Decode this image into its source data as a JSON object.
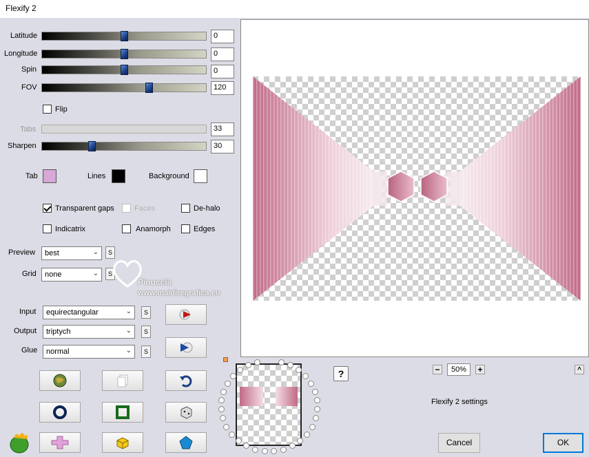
{
  "window": {
    "title": "Flexify 2"
  },
  "sliders": [
    {
      "id": "latitude",
      "label": "Latitude",
      "value": "0",
      "fraction": 0.5,
      "disabled": false
    },
    {
      "id": "longitude",
      "label": "Longitude",
      "value": "0",
      "fraction": 0.5,
      "disabled": false
    },
    {
      "id": "spin",
      "label": "Spin",
      "value": "0",
      "fraction": 0.5,
      "disabled": false
    },
    {
      "id": "fov",
      "label": "FOV",
      "value": "120",
      "fraction": 0.65,
      "disabled": false
    },
    {
      "id": "tabs",
      "label": "Tabs",
      "value": "33",
      "fraction": null,
      "disabled": true
    },
    {
      "id": "sharpen",
      "label": "Sharpen",
      "value": "30",
      "fraction": 0.3,
      "disabled": false
    }
  ],
  "flip": {
    "label": "Flip",
    "checked": false
  },
  "colors": {
    "tab": {
      "label": "Tab",
      "color": "#d8a6d8"
    },
    "lines": {
      "label": "Lines",
      "color": "#000000"
    },
    "background": {
      "label": "Background",
      "color": "#ffffff"
    }
  },
  "checkboxes": {
    "transparent_gaps": {
      "label": "Transparent gaps",
      "checked": true
    },
    "faces": {
      "label": "Faces",
      "checked": false,
      "disabled": true
    },
    "de_halo": {
      "label": "De-halo",
      "checked": false
    },
    "indicatrix": {
      "label": "Indicatrix",
      "checked": false
    },
    "anamorph": {
      "label": "Anamorph",
      "checked": false
    },
    "edges": {
      "label": "Edges",
      "checked": false
    }
  },
  "dropdowns": {
    "preview": {
      "label": "Preview",
      "value": "best"
    },
    "grid": {
      "label": "Grid",
      "value": "none"
    },
    "input": {
      "label": "Input",
      "value": "equirectangular"
    },
    "output": {
      "label": "Output",
      "value": "triptych"
    },
    "glue": {
      "label": "Glue",
      "value": "normal"
    }
  },
  "s_button_label": "S",
  "watermark": {
    "line1": "Pinuccia",
    "line2": "www.maidiregrafica.eu"
  },
  "zoom": {
    "value": "50%",
    "minus": "−",
    "plus": "+"
  },
  "help_label": "?",
  "collapse_label": "^",
  "settings_label": "Flexify 2 settings",
  "buttons": {
    "cancel": "Cancel",
    "ok": "OK"
  },
  "accent_color": "#0078d7",
  "preview_tint": "#c06a86"
}
